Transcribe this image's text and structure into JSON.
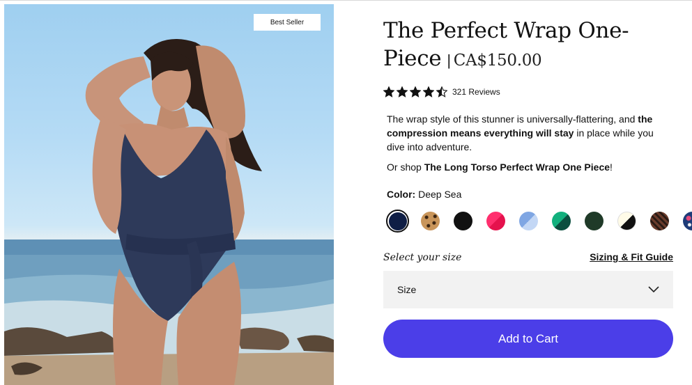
{
  "product": {
    "badge": "Best Seller",
    "title": "The Perfect Wrap One-Piece",
    "separator": "|",
    "price": "CA$150.00",
    "rating_value": 4.5,
    "rating_max": 5,
    "reviews_text": "321 Reviews",
    "description": {
      "p1_part1": "The wrap style of this stunner is universally-flattering, and ",
      "p1_bold": "the compression means everything will stay",
      "p1_part2": " in place while you dive into adventure.",
      "p2_part1": "Or shop ",
      "p2_bold": "The Long Torso Perfect Wrap One Piece",
      "p2_part2": "!"
    },
    "color_label": "Color:",
    "color_value": "Deep Sea",
    "swatches": [
      {
        "name": "deep-sea",
        "colors": [
          "#0f1e45"
        ],
        "selected": true
      },
      {
        "name": "leopard",
        "colors": [
          "#c9955a",
          "#3a2412"
        ],
        "selected": false
      },
      {
        "name": "black",
        "colors": [
          "#111111"
        ],
        "selected": false
      },
      {
        "name": "pink-red",
        "colors": [
          "#ff2f6e",
          "#e5124d"
        ],
        "selected": false
      },
      {
        "name": "periwinkle",
        "colors": [
          "#7fa6e3",
          "#c3d7f5"
        ],
        "selected": false
      },
      {
        "name": "green-teal",
        "colors": [
          "#12b07d",
          "#0b4f3f"
        ],
        "selected": false
      },
      {
        "name": "forest",
        "colors": [
          "#1f3a28"
        ],
        "selected": false
      },
      {
        "name": "black-white",
        "colors": [
          "#fffbe8",
          "#111111"
        ],
        "selected": false
      },
      {
        "name": "stripe",
        "colors": [
          "#6a3b2b",
          "#2a1a14"
        ],
        "selected": false
      },
      {
        "name": "floral",
        "colors": [
          "#1d3b78",
          "#f2c12e"
        ],
        "selected": false
      }
    ],
    "size_prompt": "Select your size",
    "size_guide": "Sizing & Fit Guide",
    "size_placeholder": "Size",
    "add_to_cart": "Add to Cart"
  },
  "colors": {
    "button": "#4b3ee8",
    "select_bg": "#f2f2f2"
  },
  "icons": {
    "star": "star-icon",
    "chevron": "chevron-down-icon"
  }
}
